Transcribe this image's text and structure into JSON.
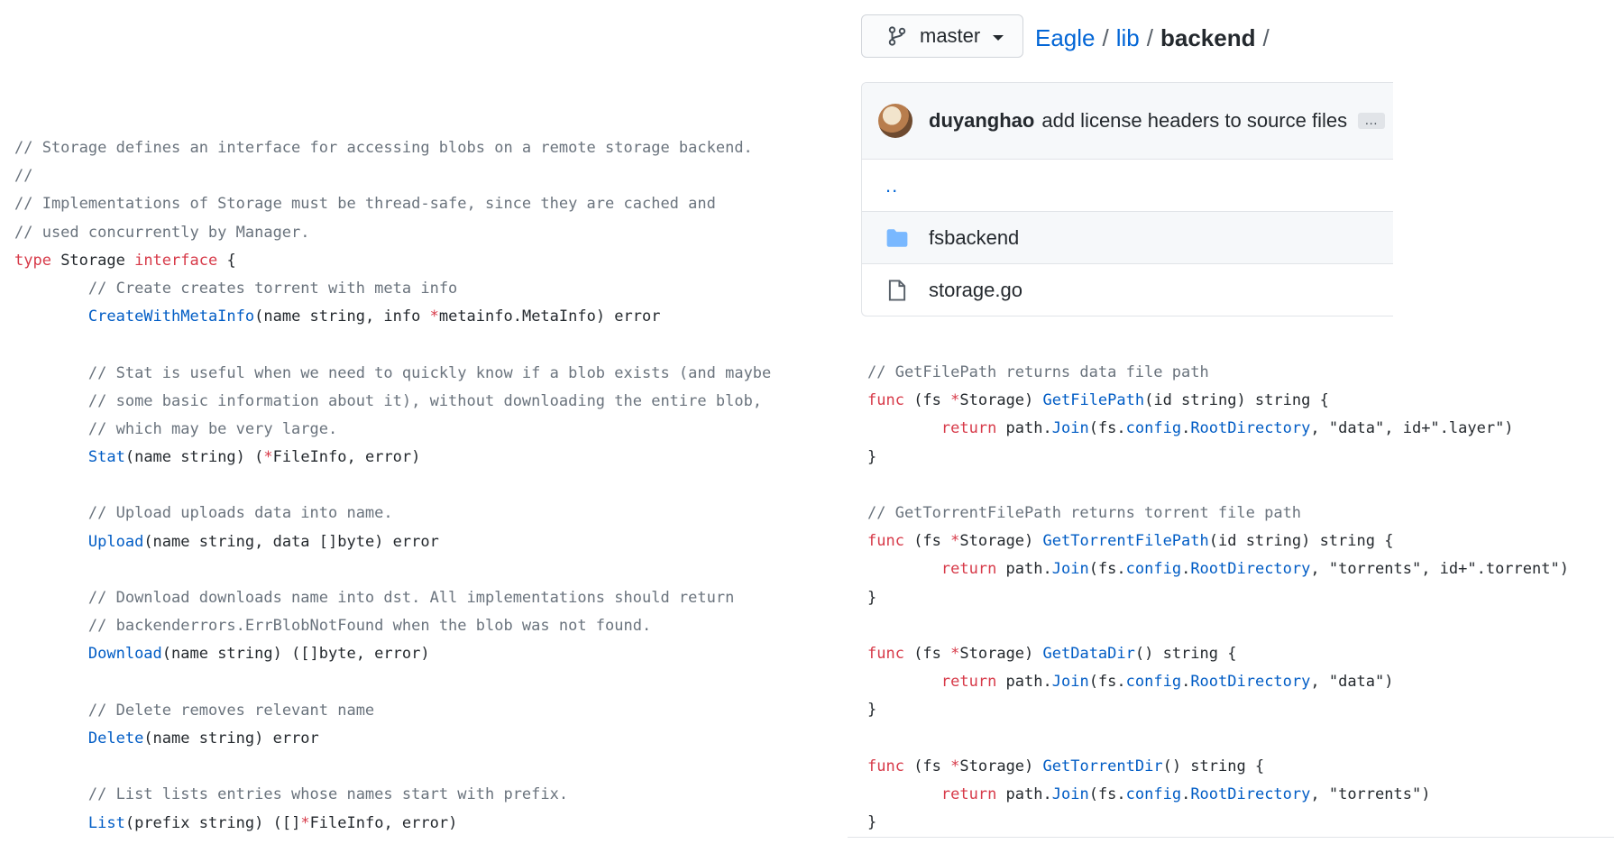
{
  "branch": {
    "name": "master",
    "icon": "git-branch-icon",
    "dropdown_icon": "caret-down-icon"
  },
  "breadcrumb": {
    "items": [
      "Eagle",
      "lib",
      "backend"
    ],
    "separator": "/"
  },
  "commit": {
    "author": "duyanghao",
    "message": "add license headers to source files",
    "more": "…"
  },
  "files": [
    {
      "name": "..",
      "type": "parent"
    },
    {
      "name": "fsbackend",
      "type": "directory",
      "icon": "folder-icon"
    },
    {
      "name": "storage.go",
      "type": "file",
      "icon": "file-icon"
    }
  ],
  "colors": {
    "link": "#0366d6",
    "keyword": "#d73a49",
    "function": "#005cc5",
    "comment": "#6a737d",
    "text": "#24292e",
    "folder": "#79b8ff"
  },
  "left_code": [
    [
      [
        "cm",
        "// Storage defines an interface for accessing blobs on a remote storage backend."
      ]
    ],
    [
      [
        "cm",
        "//"
      ]
    ],
    [
      [
        "cm",
        "// Implementations of Storage must be thread-safe, since they are cached and"
      ]
    ],
    [
      [
        "cm",
        "// used concurrently by Manager."
      ]
    ],
    [
      [
        "kw",
        "type"
      ],
      [
        "pl",
        " Storage "
      ],
      [
        "kw",
        "interface"
      ],
      [
        "pl",
        " {"
      ]
    ],
    [
      [
        "pl",
        "        "
      ],
      [
        "cm",
        "// Create creates torrent with meta info"
      ]
    ],
    [
      [
        "pl",
        "        "
      ],
      [
        "fn",
        "CreateWithMetaInfo"
      ],
      [
        "pl",
        "(name string, info "
      ],
      [
        "kw",
        "*"
      ],
      [
        "pl",
        "metainfo.MetaInfo) error"
      ]
    ],
    [
      [
        "pl",
        ""
      ]
    ],
    [
      [
        "pl",
        "        "
      ],
      [
        "cm",
        "// Stat is useful when we need to quickly know if a blob exists (and maybe"
      ]
    ],
    [
      [
        "pl",
        "        "
      ],
      [
        "cm",
        "// some basic information about it), without downloading the entire blob,"
      ]
    ],
    [
      [
        "pl",
        "        "
      ],
      [
        "cm",
        "// which may be very large."
      ]
    ],
    [
      [
        "pl",
        "        "
      ],
      [
        "fn",
        "Stat"
      ],
      [
        "pl",
        "(name string) ("
      ],
      [
        "kw",
        "*"
      ],
      [
        "pl",
        "FileInfo, error)"
      ]
    ],
    [
      [
        "pl",
        ""
      ]
    ],
    [
      [
        "pl",
        "        "
      ],
      [
        "cm",
        "// Upload uploads data into name."
      ]
    ],
    [
      [
        "pl",
        "        "
      ],
      [
        "fn",
        "Upload"
      ],
      [
        "pl",
        "(name string, data []byte) error"
      ]
    ],
    [
      [
        "pl",
        ""
      ]
    ],
    [
      [
        "pl",
        "        "
      ],
      [
        "cm",
        "// Download downloads name into dst. All implementations should return"
      ]
    ],
    [
      [
        "pl",
        "        "
      ],
      [
        "cm",
        "// backenderrors.ErrBlobNotFound when the blob was not found."
      ]
    ],
    [
      [
        "pl",
        "        "
      ],
      [
        "fn",
        "Download"
      ],
      [
        "pl",
        "(name string) ([]byte, error)"
      ]
    ],
    [
      [
        "pl",
        ""
      ]
    ],
    [
      [
        "pl",
        "        "
      ],
      [
        "cm",
        "// Delete removes relevant name"
      ]
    ],
    [
      [
        "pl",
        "        "
      ],
      [
        "fn",
        "Delete"
      ],
      [
        "pl",
        "(name string) error"
      ]
    ],
    [
      [
        "pl",
        ""
      ]
    ],
    [
      [
        "pl",
        "        "
      ],
      [
        "cm",
        "// List lists entries whose names start with prefix."
      ]
    ],
    [
      [
        "pl",
        "        "
      ],
      [
        "fn",
        "List"
      ],
      [
        "pl",
        "(prefix string) ([]"
      ],
      [
        "kw",
        "*"
      ],
      [
        "pl",
        "FileInfo, error)"
      ]
    ]
  ],
  "right_code": [
    [
      [
        "cm",
        "// GetFilePath returns data file path"
      ]
    ],
    [
      [
        "kw",
        "func"
      ],
      [
        "pl",
        " (fs "
      ],
      [
        "kw",
        "*"
      ],
      [
        "pl",
        "Storage) "
      ],
      [
        "fn",
        "GetFilePath"
      ],
      [
        "pl",
        "(id string) string {"
      ]
    ],
    [
      [
        "pl",
        "        "
      ],
      [
        "kw",
        "return"
      ],
      [
        "pl",
        " path."
      ],
      [
        "fn",
        "Join"
      ],
      [
        "pl",
        "(fs."
      ],
      [
        "fn",
        "config"
      ],
      [
        "pl",
        "."
      ],
      [
        "fn",
        "RootDirectory"
      ],
      [
        "pl",
        ", \"data\", id+\".layer\")"
      ]
    ],
    [
      [
        "pl",
        "}"
      ]
    ],
    [
      [
        "pl",
        ""
      ]
    ],
    [
      [
        "cm",
        "// GetTorrentFilePath returns torrent file path"
      ]
    ],
    [
      [
        "kw",
        "func"
      ],
      [
        "pl",
        " (fs "
      ],
      [
        "kw",
        "*"
      ],
      [
        "pl",
        "Storage) "
      ],
      [
        "fn",
        "GetTorrentFilePath"
      ],
      [
        "pl",
        "(id string) string {"
      ]
    ],
    [
      [
        "pl",
        "        "
      ],
      [
        "kw",
        "return"
      ],
      [
        "pl",
        " path."
      ],
      [
        "fn",
        "Join"
      ],
      [
        "pl",
        "(fs."
      ],
      [
        "fn",
        "config"
      ],
      [
        "pl",
        "."
      ],
      [
        "fn",
        "RootDirectory"
      ],
      [
        "pl",
        ", \"torrents\", id+\".torrent\")"
      ]
    ],
    [
      [
        "pl",
        "}"
      ]
    ],
    [
      [
        "pl",
        ""
      ]
    ],
    [
      [
        "kw",
        "func"
      ],
      [
        "pl",
        " (fs "
      ],
      [
        "kw",
        "*"
      ],
      [
        "pl",
        "Storage) "
      ],
      [
        "fn",
        "GetDataDir"
      ],
      [
        "pl",
        "() string {"
      ]
    ],
    [
      [
        "pl",
        "        "
      ],
      [
        "kw",
        "return"
      ],
      [
        "pl",
        " path."
      ],
      [
        "fn",
        "Join"
      ],
      [
        "pl",
        "(fs."
      ],
      [
        "fn",
        "config"
      ],
      [
        "pl",
        "."
      ],
      [
        "fn",
        "RootDirectory"
      ],
      [
        "pl",
        ", \"data\")"
      ]
    ],
    [
      [
        "pl",
        "}"
      ]
    ],
    [
      [
        "pl",
        ""
      ]
    ],
    [
      [
        "kw",
        "func"
      ],
      [
        "pl",
        " (fs "
      ],
      [
        "kw",
        "*"
      ],
      [
        "pl",
        "Storage) "
      ],
      [
        "fn",
        "GetTorrentDir"
      ],
      [
        "pl",
        "() string {"
      ]
    ],
    [
      [
        "pl",
        "        "
      ],
      [
        "kw",
        "return"
      ],
      [
        "pl",
        " path."
      ],
      [
        "fn",
        "Join"
      ],
      [
        "pl",
        "(fs."
      ],
      [
        "fn",
        "config"
      ],
      [
        "pl",
        "."
      ],
      [
        "fn",
        "RootDirectory"
      ],
      [
        "pl",
        ", \"torrents\")"
      ]
    ],
    [
      [
        "pl",
        "}"
      ]
    ]
  ]
}
